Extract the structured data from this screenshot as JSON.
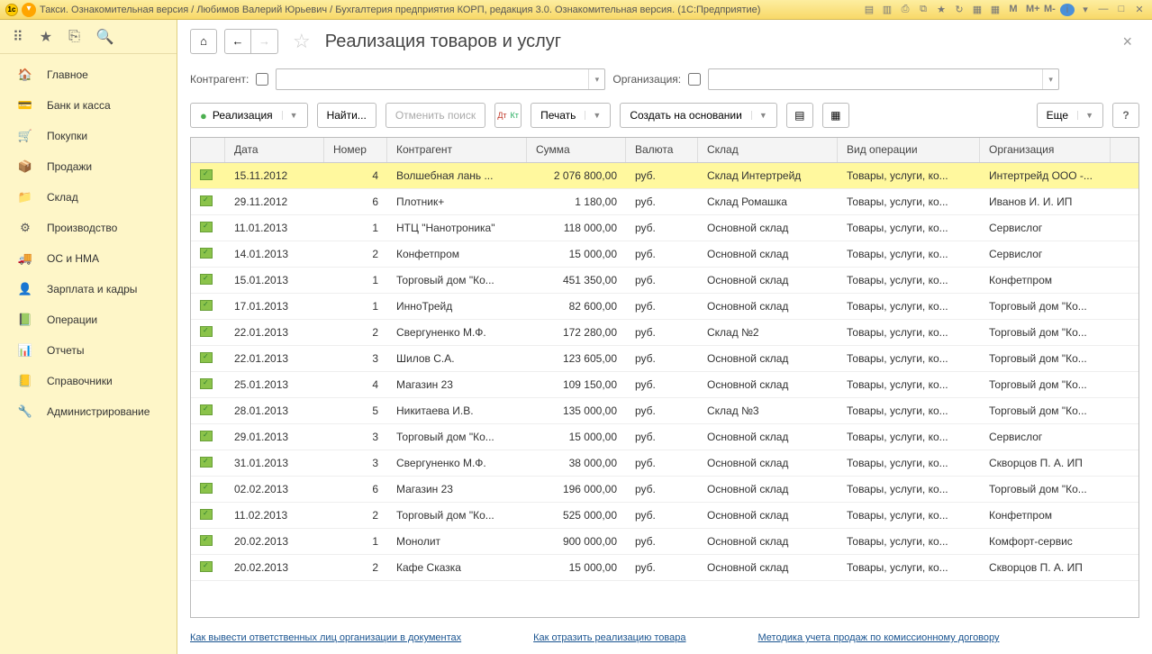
{
  "titleBar": {
    "text": "Такси. Ознакомительная версия / Любимов Валерий Юрьевич / Бухгалтерия предприятия КОРП, редакция 3.0. Ознакомительная версия.  (1С:Предприятие)"
  },
  "sidebar": {
    "items": [
      {
        "label": "Главное",
        "icon": "🏠",
        "cls": "sb-home"
      },
      {
        "label": "Банк и касса",
        "icon": "💳",
        "cls": "sb-bank"
      },
      {
        "label": "Покупки",
        "icon": "🛒",
        "cls": "sb-cart"
      },
      {
        "label": "Продажи",
        "icon": "📦",
        "cls": "sb-sales"
      },
      {
        "label": "Склад",
        "icon": "📁",
        "cls": "sb-store"
      },
      {
        "label": "Производство",
        "icon": "⚙",
        "cls": "sb-prod"
      },
      {
        "label": "ОС и НМА",
        "icon": "🚚",
        "cls": "sb-os"
      },
      {
        "label": "Зарплата и кадры",
        "icon": "👤",
        "cls": "sb-zp"
      },
      {
        "label": "Операции",
        "icon": "📗",
        "cls": "sb-oper"
      },
      {
        "label": "Отчеты",
        "icon": "📊",
        "cls": "sb-rep"
      },
      {
        "label": "Справочники",
        "icon": "📒",
        "cls": "sb-ref"
      },
      {
        "label": "Администрирование",
        "icon": "🔧",
        "cls": "sb-adm"
      }
    ]
  },
  "page": {
    "title": "Реализация товаров и услуг"
  },
  "filters": {
    "contragent_label": "Контрагент:",
    "org_label": "Организация:"
  },
  "toolbar": {
    "realize": "Реализация",
    "find": "Найти...",
    "cancel_search": "Отменить поиск",
    "print": "Печать",
    "create_based": "Создать на основании",
    "more": "Еще"
  },
  "columns": {
    "date": "Дата",
    "number": "Номер",
    "contragent": "Контрагент",
    "sum": "Сумма",
    "currency": "Валюта",
    "store": "Склад",
    "operation": "Вид операции",
    "org": "Организация"
  },
  "rows": [
    {
      "date": "15.11.2012",
      "num": "4",
      "contr": "Волшебная лань ...",
      "sum": "2 076 800,00",
      "cur": "руб.",
      "store": "Склад Интертрейд",
      "oper": "Товары, услуги, ко...",
      "org": "Интертрейд ООО -...",
      "selected": true
    },
    {
      "date": "29.11.2012",
      "num": "6",
      "contr": "Плотник+",
      "sum": "1 180,00",
      "cur": "руб.",
      "store": "Склад Ромашка",
      "oper": "Товары, услуги, ко...",
      "org": "Иванов И. И. ИП"
    },
    {
      "date": "11.01.2013",
      "num": "1",
      "contr": "НТЦ \"Нанотроника\"",
      "sum": "118 000,00",
      "cur": "руб.",
      "store": "Основной склад",
      "oper": "Товары, услуги, ко...",
      "org": "Сервислог"
    },
    {
      "date": "14.01.2013",
      "num": "2",
      "contr": "Конфетпром",
      "sum": "15 000,00",
      "cur": "руб.",
      "store": "Основной склад",
      "oper": "Товары, услуги, ко...",
      "org": "Сервислог"
    },
    {
      "date": "15.01.2013",
      "num": "1",
      "contr": "Торговый дом \"Ко...",
      "sum": "451 350,00",
      "cur": "руб.",
      "store": "Основной склад",
      "oper": "Товары, услуги, ко...",
      "org": "Конфетпром"
    },
    {
      "date": "17.01.2013",
      "num": "1",
      "contr": "ИнноТрейд",
      "sum": "82 600,00",
      "cur": "руб.",
      "store": "Основной склад",
      "oper": "Товары, услуги, ко...",
      "org": "Торговый дом \"Ко..."
    },
    {
      "date": "22.01.2013",
      "num": "2",
      "contr": "Свергуненко М.Ф.",
      "sum": "172 280,00",
      "cur": "руб.",
      "store": "Склад №2",
      "oper": "Товары, услуги, ко...",
      "org": "Торговый дом \"Ко..."
    },
    {
      "date": "22.01.2013",
      "num": "3",
      "contr": "Шилов С.А.",
      "sum": "123 605,00",
      "cur": "руб.",
      "store": "Основной склад",
      "oper": "Товары, услуги, ко...",
      "org": "Торговый дом \"Ко..."
    },
    {
      "date": "25.01.2013",
      "num": "4",
      "contr": "Магазин 23",
      "sum": "109 150,00",
      "cur": "руб.",
      "store": "Основной склад",
      "oper": "Товары, услуги, ко...",
      "org": "Торговый дом \"Ко..."
    },
    {
      "date": "28.01.2013",
      "num": "5",
      "contr": "Никитаева И.В.",
      "sum": "135 000,00",
      "cur": "руб.",
      "store": "Склад №3",
      "oper": "Товары, услуги, ко...",
      "org": "Торговый дом \"Ко..."
    },
    {
      "date": "29.01.2013",
      "num": "3",
      "contr": "Торговый дом \"Ко...",
      "sum": "15 000,00",
      "cur": "руб.",
      "store": "Основной склад",
      "oper": "Товары, услуги, ко...",
      "org": "Сервислог"
    },
    {
      "date": "31.01.2013",
      "num": "3",
      "contr": "Свергуненко М.Ф.",
      "sum": "38 000,00",
      "cur": "руб.",
      "store": "Основной склад",
      "oper": "Товары, услуги, ко...",
      "org": "Скворцов П. А. ИП"
    },
    {
      "date": "02.02.2013",
      "num": "6",
      "contr": "Магазин 23",
      "sum": "196 000,00",
      "cur": "руб.",
      "store": "Основной склад",
      "oper": "Товары, услуги, ко...",
      "org": "Торговый дом \"Ко..."
    },
    {
      "date": "11.02.2013",
      "num": "2",
      "contr": "Торговый дом \"Ко...",
      "sum": "525 000,00",
      "cur": "руб.",
      "store": "Основной склад",
      "oper": "Товары, услуги, ко...",
      "org": "Конфетпром"
    },
    {
      "date": "20.02.2013",
      "num": "1",
      "contr": "Монолит",
      "sum": "900 000,00",
      "cur": "руб.",
      "store": "Основной склад",
      "oper": "Товары, услуги, ко...",
      "org": "Комфорт-сервис"
    },
    {
      "date": "20.02.2013",
      "num": "2",
      "contr": "Кафе Сказка",
      "sum": "15 000,00",
      "cur": "руб.",
      "store": "Основной склад",
      "oper": "Товары, услуги, ко...",
      "org": "Скворцов П. А. ИП"
    }
  ],
  "footer": {
    "link1": "Как вывести ответственных лиц организации в документах",
    "link2": "Как отразить реализацию товара",
    "link3": "Методика учета продаж по комиссионному договору"
  }
}
